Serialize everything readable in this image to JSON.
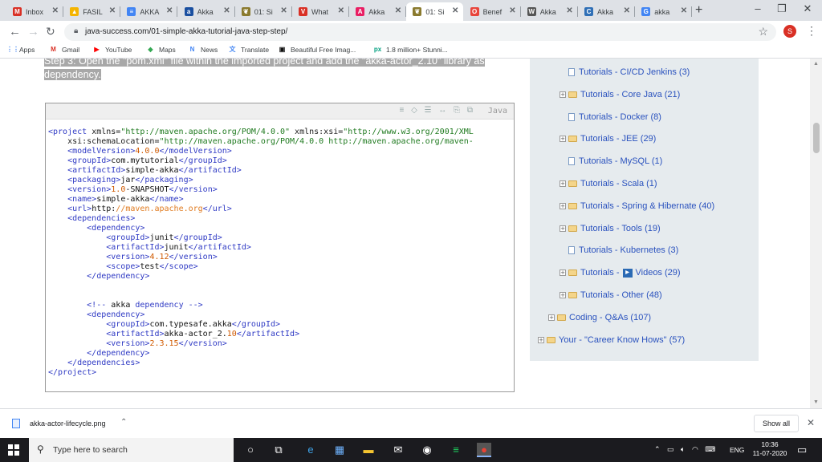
{
  "browser": {
    "tabs": [
      {
        "title": "Inbox",
        "fav": "M",
        "fav_color": "#d93025",
        "active": false
      },
      {
        "title": "FASIL",
        "fav": "▲",
        "fav_color": "#f4b400",
        "active": false
      },
      {
        "title": "AKKA",
        "fav": "≡",
        "fav_color": "#4285f4",
        "active": false
      },
      {
        "title": "Akka",
        "fav": "a",
        "fav_color": "#1a4fa0",
        "active": false
      },
      {
        "title": "01: Si",
        "fav": "❦",
        "fav_color": "#8a7a2e",
        "active": false
      },
      {
        "title": "What",
        "fav": "V",
        "fav_color": "#d93025",
        "active": false
      },
      {
        "title": "Akka",
        "fav": "A",
        "fav_color": "#e91e63",
        "active": false
      },
      {
        "title": "01: Si",
        "fav": "❦",
        "fav_color": "#8a7a2e",
        "active": true
      },
      {
        "title": "Benef",
        "fav": "O",
        "fav_color": "#e8453c",
        "active": false
      },
      {
        "title": "Akka",
        "fav": "W",
        "fav_color": "#555555",
        "active": false
      },
      {
        "title": "Akka",
        "fav": "C",
        "fav_color": "#2f6fb6",
        "active": false
      },
      {
        "title": "akka",
        "fav": "G",
        "fav_color": "#4285f4",
        "active": false
      }
    ],
    "url": "java-success.com/01-simple-akka-tutorial-java-step-step/",
    "profile_initial": "S",
    "bookmarks": [
      {
        "label": "Apps",
        "icon": "⋮⋮",
        "color": "#4285f4"
      },
      {
        "label": "Gmail",
        "icon": "M",
        "color": "#d93025"
      },
      {
        "label": "YouTube",
        "icon": "▶",
        "color": "#ff0000"
      },
      {
        "label": "Maps",
        "icon": "◆",
        "color": "#34a853"
      },
      {
        "label": "News",
        "icon": "N",
        "color": "#4285f4"
      },
      {
        "label": "Translate",
        "icon": "文",
        "color": "#4285f4"
      },
      {
        "label": "Beautiful Free Imag...",
        "icon": "▣",
        "color": "#111111"
      },
      {
        "label": "1.8 million+ Stunni...",
        "icon": "px",
        "color": "#05a081"
      }
    ]
  },
  "page": {
    "step_text": "Step 3: Open the \"pom.xml\" file within the imported project and add the \"akka-actor_2.10\" library as dependency.",
    "code_language": "Java",
    "code_lines": [
      [
        [
          "t-tag",
          "<project "
        ],
        [
          "t-att",
          "xmlns="
        ],
        [
          "t-str",
          "\"http://maven.apache.org/POM/4.0.0\""
        ],
        [
          "t-att",
          " xmlns:xsi="
        ],
        [
          "t-str",
          "\"http://www.w3.org/2001/XML"
        ]
      ],
      [
        [
          "t-att",
          "    xsi:schemaLocation="
        ],
        [
          "t-str",
          "\"http://maven.apache.org/POM/4.0.0 http://maven.apache.org/maven-"
        ]
      ],
      [
        [
          "t-tag",
          "    <modelVersion>"
        ],
        [
          "t-num",
          "4.0.0"
        ],
        [
          "t-tag",
          "</modelVersion>"
        ]
      ],
      [
        [
          "t-tag",
          "    <groupId>"
        ],
        [
          "t-txt",
          "com.mytutorial"
        ],
        [
          "t-tag",
          "</groupId>"
        ]
      ],
      [
        [
          "t-tag",
          "    <artifactId>"
        ],
        [
          "t-txt",
          "simple-akka"
        ],
        [
          "t-tag",
          "</artifactId>"
        ]
      ],
      [
        [
          "t-tag",
          "    <packaging>"
        ],
        [
          "t-txt",
          "jar"
        ],
        [
          "t-tag",
          "</packaging>"
        ]
      ],
      [
        [
          "t-tag",
          "    <version>"
        ],
        [
          "t-num",
          "1.0"
        ],
        [
          "t-txt",
          "-SNAPSHOT"
        ],
        [
          "t-tag",
          "</version>"
        ]
      ],
      [
        [
          "t-tag",
          "    <name>"
        ],
        [
          "t-txt",
          "simple-akka"
        ],
        [
          "t-tag",
          "</name>"
        ]
      ],
      [
        [
          "t-tag",
          "    <url>"
        ],
        [
          "t-txt",
          "http:"
        ],
        [
          "t-url",
          "//maven.apache.org"
        ],
        [
          "t-tag",
          "</url>"
        ]
      ],
      [
        [
          "t-tag",
          "    <dependencies>"
        ]
      ],
      [
        [
          "t-tag",
          "        <dependency>"
        ]
      ],
      [
        [
          "t-tag",
          "            <groupId>"
        ],
        [
          "t-txt",
          "junit"
        ],
        [
          "t-tag",
          "</groupId>"
        ]
      ],
      [
        [
          "t-tag",
          "            <artifactId>"
        ],
        [
          "t-txt",
          "junit"
        ],
        [
          "t-tag",
          "</artifactId>"
        ]
      ],
      [
        [
          "t-tag",
          "            <version>"
        ],
        [
          "t-num",
          "4.12"
        ],
        [
          "t-tag",
          "</version>"
        ]
      ],
      [
        [
          "t-tag",
          "            <scope>"
        ],
        [
          "t-txt",
          "test"
        ],
        [
          "t-tag",
          "</scope>"
        ]
      ],
      [
        [
          "t-tag",
          "        </dependency>"
        ]
      ],
      [
        [
          "t-txt",
          " "
        ]
      ],
      [
        [
          "t-txt",
          " "
        ]
      ],
      [
        [
          "t-com",
          "        <!-- "
        ],
        [
          "t-txt",
          "akka"
        ],
        [
          "t-com",
          " dependency -->"
        ]
      ],
      [
        [
          "t-tag",
          "        <dependency>"
        ]
      ],
      [
        [
          "t-tag",
          "            <groupId>"
        ],
        [
          "t-txt",
          "com.typesafe.akka"
        ],
        [
          "t-tag",
          "</groupId>"
        ]
      ],
      [
        [
          "t-tag",
          "            <artifactId>"
        ],
        [
          "t-txt",
          "akka-actor_2."
        ],
        [
          "t-num",
          "10"
        ],
        [
          "t-tag",
          "</artifactId>"
        ]
      ],
      [
        [
          "t-tag",
          "            <version>"
        ],
        [
          "t-num",
          "2.3.15"
        ],
        [
          "t-tag",
          "</version>"
        ]
      ],
      [
        [
          "t-tag",
          "        </dependency>"
        ]
      ],
      [
        [
          "t-tag",
          "    </dependencies>"
        ]
      ],
      [
        [
          "t-tag",
          "</project>"
        ]
      ]
    ],
    "sidebar": [
      {
        "label": "Tutorials - CI/CD Jenkins (3)",
        "kind": "doc"
      },
      {
        "label": "Tutorials - Core Java (21)",
        "kind": "folder"
      },
      {
        "label": "Tutorials - Docker (8)",
        "kind": "doc"
      },
      {
        "label": "Tutorials - JEE (29)",
        "kind": "folder"
      },
      {
        "label": "Tutorials - MySQL (1)",
        "kind": "doc"
      },
      {
        "label": "Tutorials - Scala (1)",
        "kind": "folder"
      },
      {
        "label": "Tutorials - Spring & Hibernate (40)",
        "kind": "folder"
      },
      {
        "label": "Tutorials - Tools (19)",
        "kind": "folder"
      },
      {
        "label": "Tutorials - Kubernetes (3)",
        "kind": "doc"
      },
      {
        "label": "Tutorials - ",
        "label2": "Videos (29)",
        "kind": "video"
      },
      {
        "label": "Tutorials - Other (48)",
        "kind": "folder"
      },
      {
        "label": "Coding - Q&As (107)",
        "kind": "folder1"
      },
      {
        "label": "Your - \"Career Know Hows\" (57)",
        "kind": "folder0"
      }
    ]
  },
  "downloads": {
    "file": "akka-actor-lifecycle.png",
    "show_all": "Show all"
  },
  "taskbar": {
    "search_placeholder": "Type here to search",
    "lang": "ENG",
    "time": "10:36",
    "date": "11-07-2020"
  }
}
